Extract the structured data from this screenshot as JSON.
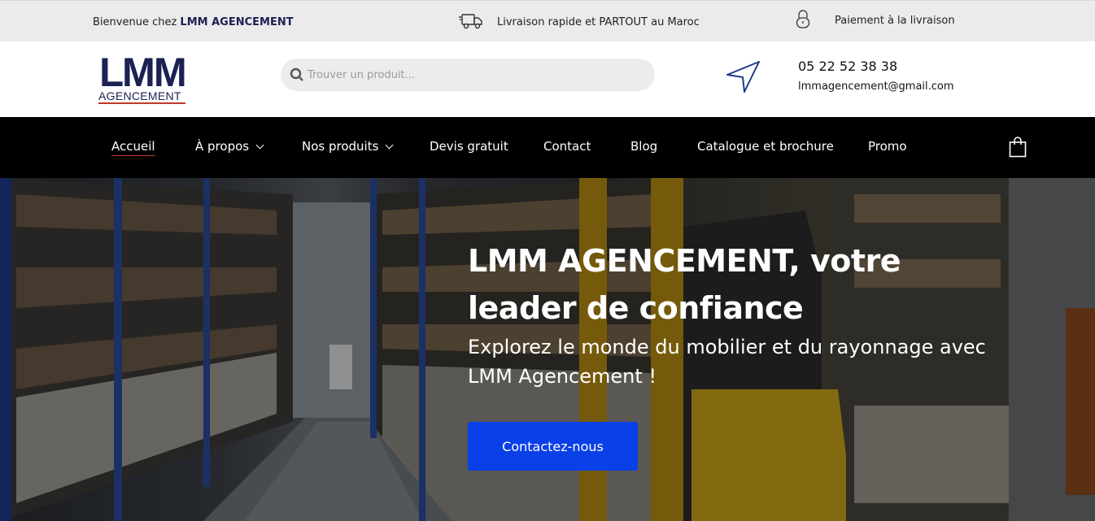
{
  "topbar": {
    "welcome_prefix": "Bienvenue chez ",
    "welcome_brand": "LMM AGENCEMENT",
    "delivery_text": "Livraison rapide et PARTOUT au Maroc",
    "payment_text": "Paiement à la livraison",
    "icons": [
      "truck-icon",
      "lock-icon"
    ]
  },
  "header": {
    "logo_main": "LMM",
    "logo_sub": "AGENCEMENT",
    "search_placeholder": "Trouver un produit...",
    "phone": "05 22 52 38 38",
    "email": "lmmagencement@gmail.com",
    "icons": [
      "search-icon",
      "send-icon"
    ]
  },
  "nav": {
    "items": [
      {
        "label": "Accueil",
        "active": true
      },
      {
        "label": "À propos",
        "dropdown": true
      },
      {
        "label": "Nos produits",
        "dropdown": true
      },
      {
        "label": "Devis gratuit"
      },
      {
        "label": "Contact"
      },
      {
        "label": "Blog"
      },
      {
        "label": "Catalogue et brochure"
      },
      {
        "label": "Promo"
      }
    ],
    "cart_icon": "shopping-bag-icon"
  },
  "hero": {
    "title": "LMM AGENCEMENT, votre leader de confiance",
    "subtitle": "Explorez le monde du mobilier et du rayonnage avec LMM Agencement !",
    "cta_label": "Contactez-nous"
  },
  "colors": {
    "brand_navy": "#1b2152",
    "accent_red": "#c0392b",
    "cta_blue": "#0a40e8",
    "nav_bg": "#000000",
    "topbar_bg": "#ebebeb"
  }
}
